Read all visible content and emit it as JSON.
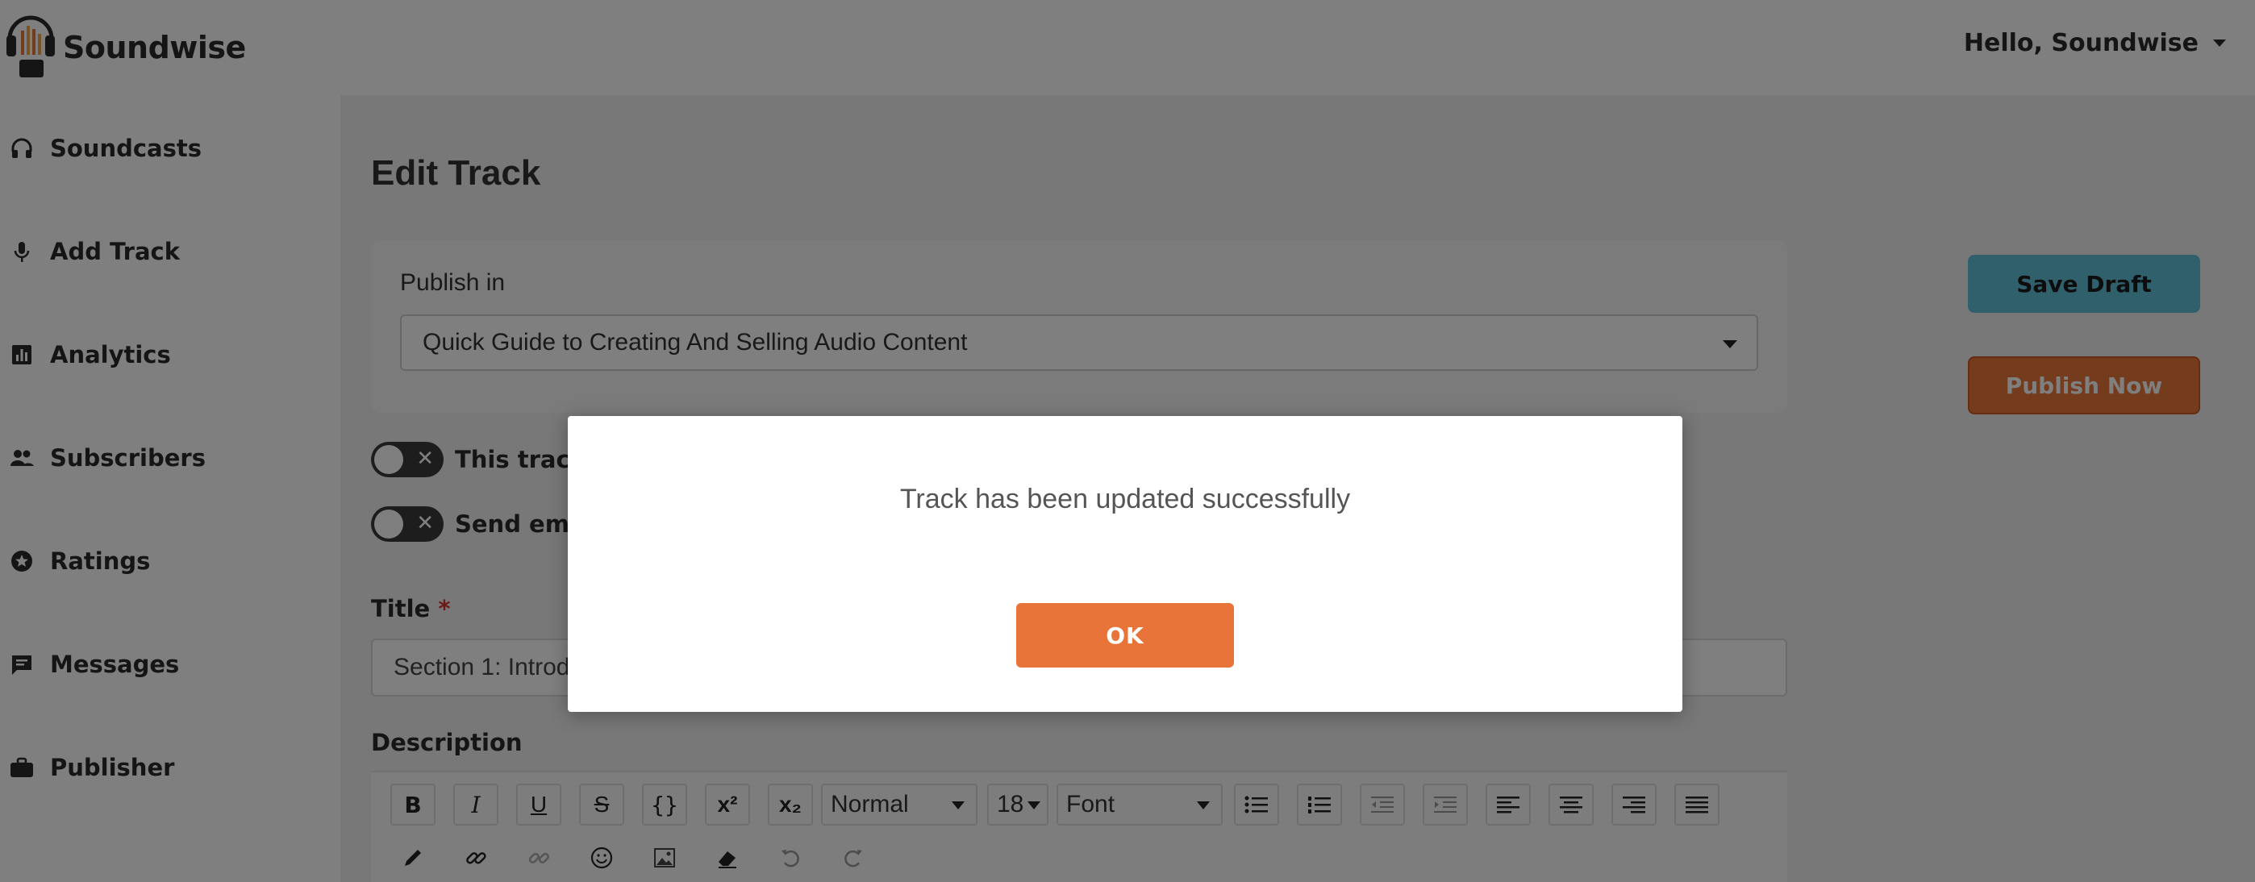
{
  "brand": {
    "name": "Soundwise",
    "logo_icon": "headphones-logo-icon"
  },
  "header": {
    "greeting": "Hello, Soundwise"
  },
  "sidebar": {
    "items": [
      {
        "label": "Soundcasts",
        "icon": "headphones-icon"
      },
      {
        "label": "Add Track",
        "icon": "microphone-icon"
      },
      {
        "label": "Analytics",
        "icon": "bar-chart-icon"
      },
      {
        "label": "Subscribers",
        "icon": "people-icon"
      },
      {
        "label": "Ratings",
        "icon": "star-icon"
      },
      {
        "label": "Messages",
        "icon": "chat-icon"
      },
      {
        "label": "Publisher",
        "icon": "briefcase-icon"
      }
    ]
  },
  "main": {
    "title": "Edit Track",
    "publish_in": {
      "label": "Publish in",
      "value": "Quick Guide to Creating And Selling Audio Content"
    },
    "toggles": [
      {
        "label": "This track"
      },
      {
        "label": "Send ema"
      }
    ],
    "title_field": {
      "label": "Title",
      "required_mark": "*",
      "value": "Section 1: Introd"
    },
    "description_label": "Description",
    "toolbar": {
      "bold": "B",
      "italic": "I",
      "underline": "U",
      "strike": "S",
      "code": "{}",
      "superscript": "x²",
      "subscript": "x₂",
      "format": "Normal",
      "size": "18",
      "font": "Font"
    },
    "save_draft": "Save Draft",
    "publish_now": "Publish Now"
  },
  "modal": {
    "message": "Track has been updated successfully",
    "ok_label": "OK"
  },
  "colors": {
    "save_draft": "#61c1d9",
    "publish_now": "#e8763a",
    "ok_button": "#e8743a",
    "overlay": "rgba(0,0,0,0.5)"
  }
}
